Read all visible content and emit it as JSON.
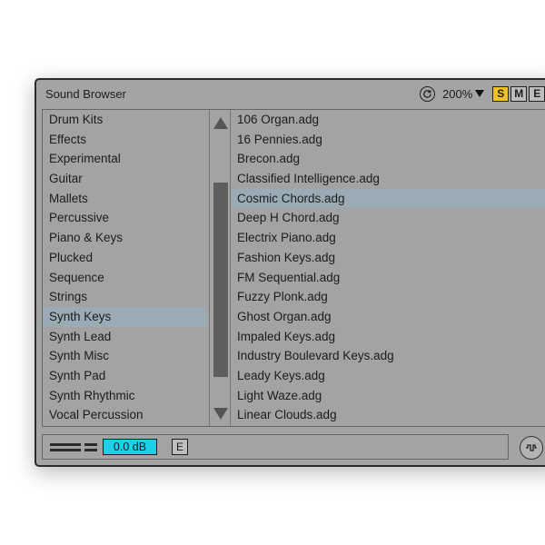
{
  "window": {
    "title": "Sound Browser"
  },
  "header": {
    "zoom": "200%",
    "solo_label": "S",
    "mute_label": "M",
    "extra_label": "E"
  },
  "categories": [
    {
      "label": "Drum Kits",
      "selected": false
    },
    {
      "label": "Effects",
      "selected": false
    },
    {
      "label": "Experimental",
      "selected": false
    },
    {
      "label": "Guitar",
      "selected": false
    },
    {
      "label": "Mallets",
      "selected": false
    },
    {
      "label": "Percussive",
      "selected": false
    },
    {
      "label": "Piano & Keys",
      "selected": false
    },
    {
      "label": "Plucked",
      "selected": false
    },
    {
      "label": "Sequence",
      "selected": false
    },
    {
      "label": "Strings",
      "selected": false
    },
    {
      "label": "Synth Keys",
      "selected": true
    },
    {
      "label": "Synth Lead",
      "selected": false
    },
    {
      "label": "Synth Misc",
      "selected": false
    },
    {
      "label": "Synth Pad",
      "selected": false
    },
    {
      "label": "Synth Rhythmic",
      "selected": false
    },
    {
      "label": "Vocal Percussion",
      "selected": false
    }
  ],
  "files": [
    {
      "label": "106 Organ.adg",
      "selected": false
    },
    {
      "label": "16 Pennies.adg",
      "selected": false
    },
    {
      "label": "Brecon.adg",
      "selected": false
    },
    {
      "label": "Classified Intelligence.adg",
      "selected": false
    },
    {
      "label": "Cosmic Chords.adg",
      "selected": true
    },
    {
      "label": "Deep H Chord.adg",
      "selected": false
    },
    {
      "label": "Electrix Piano.adg",
      "selected": false
    },
    {
      "label": "Fashion Keys.adg",
      "selected": false
    },
    {
      "label": "FM Sequential.adg",
      "selected": false
    },
    {
      "label": "Fuzzy Plonk.adg",
      "selected": false
    },
    {
      "label": "Ghost Organ.adg",
      "selected": false
    },
    {
      "label": "Impaled Keys.adg",
      "selected": false
    },
    {
      "label": "Industry Boulevard Keys.adg",
      "selected": false
    },
    {
      "label": "Leady Keys.adg",
      "selected": false
    },
    {
      "label": "Light Waze.adg",
      "selected": false
    },
    {
      "label": "Linear Clouds.adg",
      "selected": false
    }
  ],
  "footer": {
    "volume": "0.0 dB",
    "edit_label": "E"
  },
  "colors": {
    "selection": "#9aabb5",
    "solo": "#f0c21d",
    "volume_field": "#1ad1e8"
  },
  "icons": {
    "refresh": "refresh-icon",
    "zoom_caret": "caret-down-icon",
    "scroll_up": "arrow-up-icon",
    "scroll_down": "arrow-down-icon",
    "preview": "waveform-icon"
  }
}
